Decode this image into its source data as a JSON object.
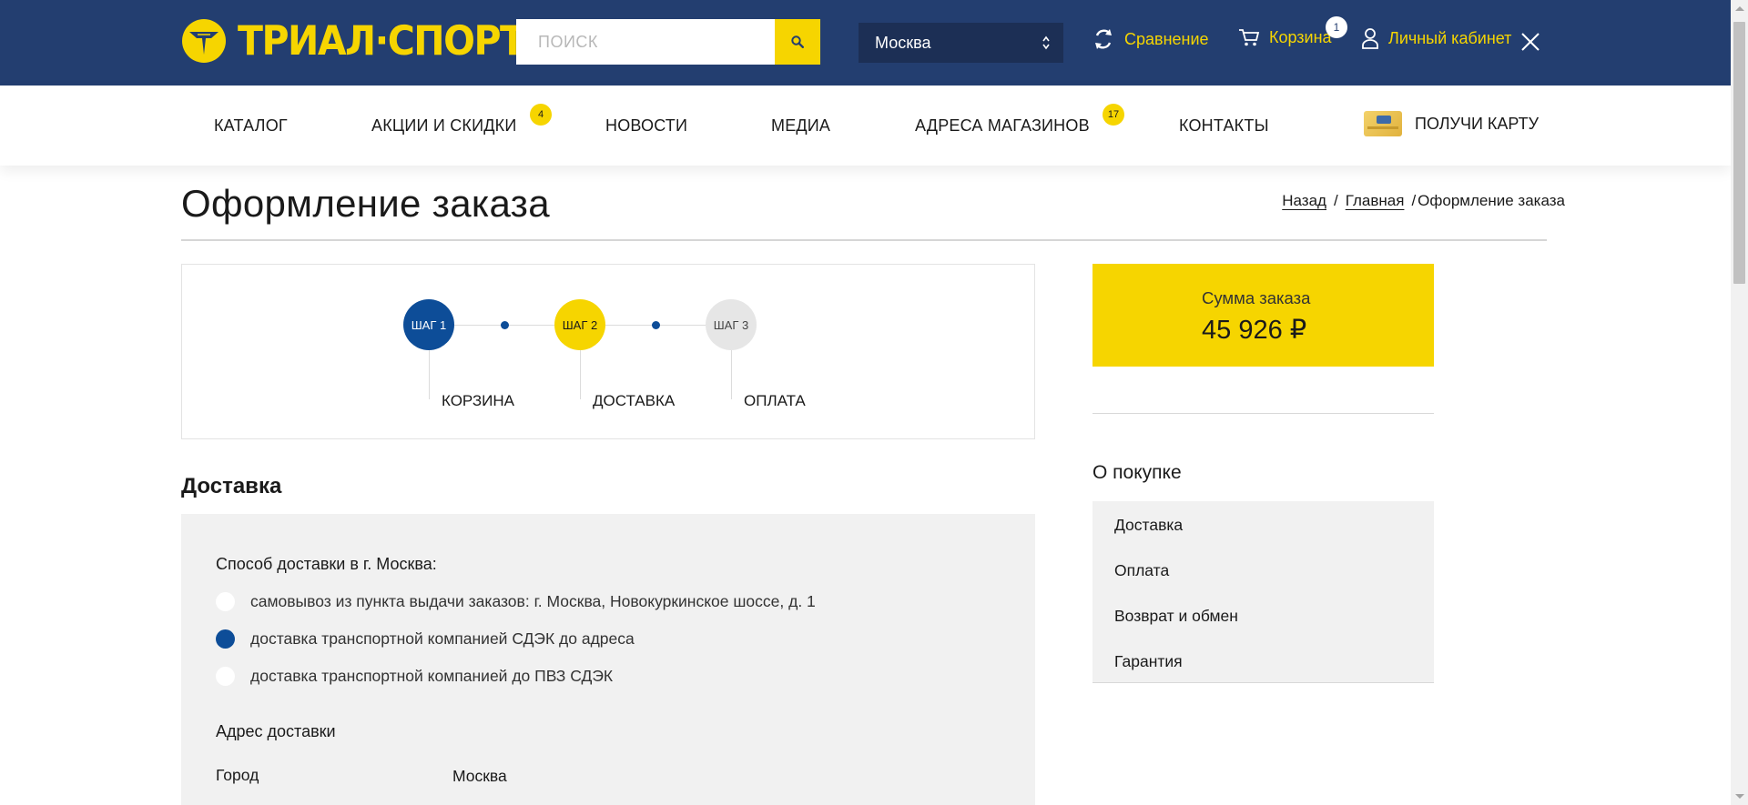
{
  "header": {
    "logo_text": "ТРИАЛ·СПОРТ",
    "search_placeholder": "ПОИСК",
    "city": "Москва",
    "compare_label": "Сравнение",
    "cart_label": "Корзина",
    "cart_count": "1",
    "account_label": "Личный кабинет",
    "brand_color": "#233e70",
    "accent_color": "#f6d500"
  },
  "nav": {
    "items": [
      {
        "label": "КАТАЛОГ"
      },
      {
        "label": "АКЦИИ И СКИДКИ",
        "badge": "4"
      },
      {
        "label": "НОВОСТИ"
      },
      {
        "label": "МЕДИА"
      },
      {
        "label": "АДРЕСА МАГАЗИНОВ",
        "badge": "17"
      },
      {
        "label": "КОНТАКТЫ"
      }
    ],
    "card_label": "ПОЛУЧИ КАРТУ"
  },
  "page": {
    "title": "Оформление заказа",
    "breadcrumb": [
      {
        "label": "Назад"
      },
      {
        "label": "Главная"
      },
      {
        "label": "Оформление заказа"
      }
    ],
    "breadcrumb_separator": "/"
  },
  "steps": [
    {
      "circle": "ШАГ 1",
      "label": "КОРЗИНА",
      "state": "done"
    },
    {
      "circle": "ШАГ 2",
      "label": "ДОСТАВКА",
      "state": "current"
    },
    {
      "circle": "ШАГ 3",
      "label": "ОПЛАТА",
      "state": "pending"
    }
  ],
  "delivery": {
    "section_title": "Доставка",
    "method_caption": "Способ доставки в г. Москва:",
    "options": [
      {
        "label": "самовывоз из пункта выдачи заказов: г. Москва, Новокуркинское шоссе, д. 1",
        "selected": false
      },
      {
        "label": "доставка транспортной компанией СДЭК до адреса",
        "selected": true
      },
      {
        "label": "доставка транспортной компанией до ПВЗ СДЭК",
        "selected": false
      }
    ],
    "address_title": "Адрес доставки",
    "city_label": "Город",
    "city_value": "Москва"
  },
  "summary": {
    "label": "Сумма заказа",
    "value": "45 926 ₽"
  },
  "about": {
    "title": "О покупке",
    "items": [
      "Доставка",
      "Оплата",
      "Возврат и обмен",
      "Гарантия"
    ]
  }
}
